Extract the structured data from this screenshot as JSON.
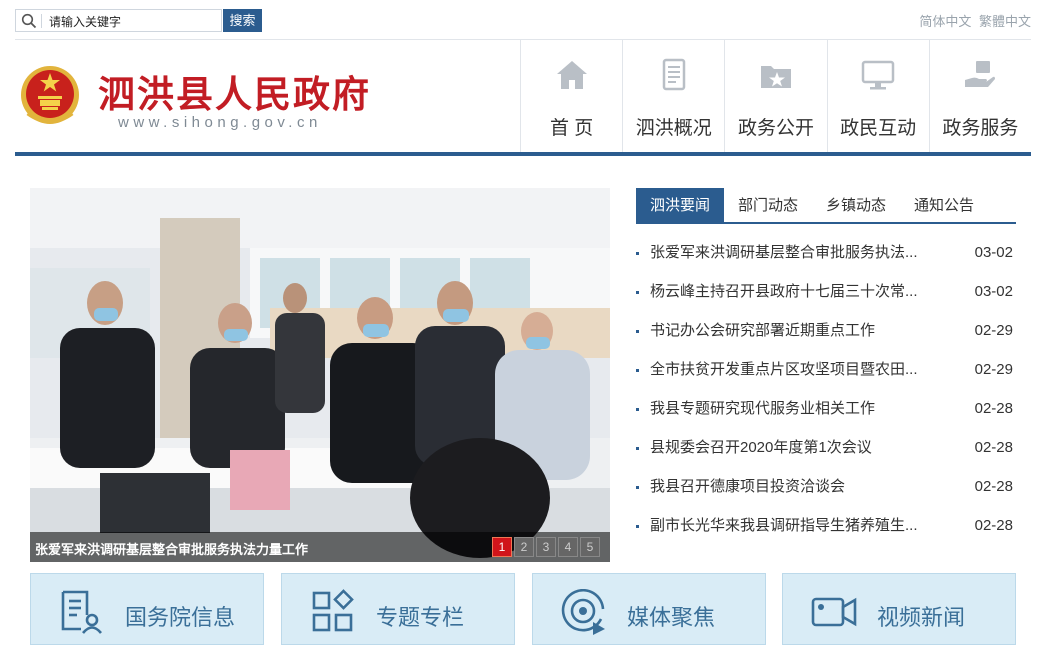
{
  "search": {
    "placeholder": "请输入关键字",
    "button_label": "搜索"
  },
  "language": {
    "simplified": "简体中文",
    "traditional": "繁體中文"
  },
  "site": {
    "title": "泗洪县人民政府",
    "url": "www.sihong.gov.cn"
  },
  "nav": [
    {
      "label": "首 页",
      "icon": "home-icon"
    },
    {
      "label": "泗洪概况",
      "icon": "document-icon"
    },
    {
      "label": "政务公开",
      "icon": "folder-star-icon"
    },
    {
      "label": "政民互动",
      "icon": "monitor-icon"
    },
    {
      "label": "政务服务",
      "icon": "hand-service-icon"
    }
  ],
  "carousel": {
    "caption": "张爱军来洪调研基层整合审批服务执法力量工作",
    "pages": [
      "1",
      "2",
      "3",
      "4",
      "5"
    ],
    "active_page": 1
  },
  "news": {
    "tabs": [
      "泗洪要闻",
      "部门动态",
      "乡镇动态",
      "通知公告"
    ],
    "active_tab": 0,
    "items": [
      {
        "title": "张爱军来洪调研基层整合审批服务执法...",
        "date": "03-02"
      },
      {
        "title": "杨云峰主持召开县政府十七届三十次常...",
        "date": "03-02"
      },
      {
        "title": "书记办公会研究部署近期重点工作",
        "date": "02-29"
      },
      {
        "title": "全市扶贫开发重点片区攻坚项目暨农田...",
        "date": "02-29"
      },
      {
        "title": "我县专题研究现代服务业相关工作",
        "date": "02-28"
      },
      {
        "title": "县规委会召开2020年度第1次会议",
        "date": "02-28"
      },
      {
        "title": "我县召开德康项目投资洽谈会",
        "date": "02-28"
      },
      {
        "title": "副市长光华来我县调研指导生猪养殖生...",
        "date": "02-28"
      }
    ]
  },
  "cards": [
    {
      "label": "国务院信息",
      "icon": "person-document-icon"
    },
    {
      "label": "专题专栏",
      "icon": "grid-diamond-icon"
    },
    {
      "label": "媒体聚焦",
      "icon": "media-disc-icon"
    },
    {
      "label": "视频新闻",
      "icon": "video-camera-icon"
    }
  ],
  "colors": {
    "brand_blue": "#2b5c8f",
    "title_red": "#c21d24",
    "card_bg": "#d9ecf6",
    "card_text": "#3a6f98"
  }
}
